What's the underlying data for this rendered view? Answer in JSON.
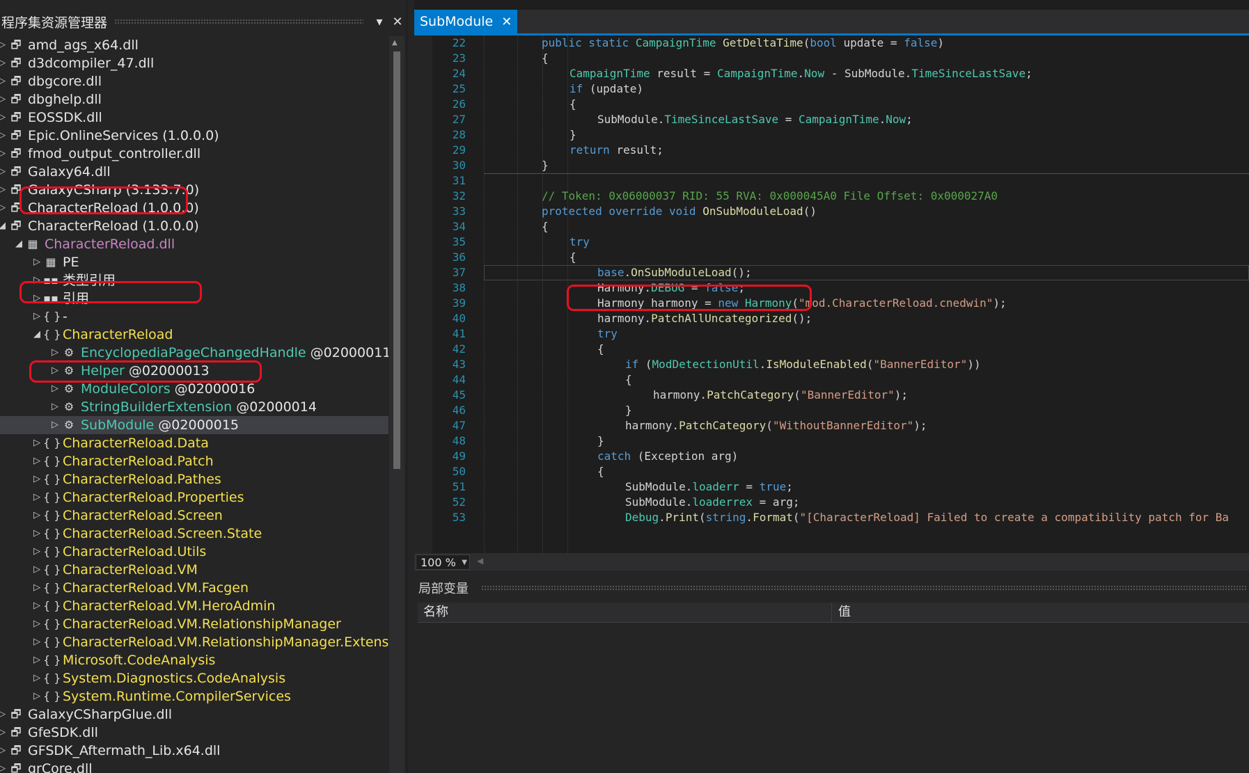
{
  "explorer": {
    "title": "程序集资源管理器",
    "pin_icon": "▾",
    "close_icon": "✕",
    "rows": [
      {
        "level": 0,
        "arrow": "▷",
        "icon": "assembly-icon",
        "glyph": "🗗",
        "text": "amd_ags_x64.dll",
        "color": "white"
      },
      {
        "level": 0,
        "arrow": "▷",
        "icon": "assembly-icon",
        "glyph": "🗗",
        "text": "d3dcompiler_47.dll",
        "color": "white"
      },
      {
        "level": 0,
        "arrow": "▷",
        "icon": "assembly-icon",
        "glyph": "🗗",
        "text": "dbgcore.dll",
        "color": "white"
      },
      {
        "level": 0,
        "arrow": "▷",
        "icon": "assembly-icon",
        "glyph": "🗗",
        "text": "dbghelp.dll",
        "color": "white"
      },
      {
        "level": 0,
        "arrow": "▷",
        "icon": "assembly-icon",
        "glyph": "🗗",
        "text": "EOSSDK.dll",
        "color": "white"
      },
      {
        "level": 0,
        "arrow": "▷",
        "icon": "assembly-icon",
        "glyph": "🗗",
        "text": "Epic.OnlineServices (1.0.0.0)",
        "color": "white"
      },
      {
        "level": 0,
        "arrow": "▷",
        "icon": "assembly-icon",
        "glyph": "🗗",
        "text": "fmod_output_controller.dll",
        "color": "white"
      },
      {
        "level": 0,
        "arrow": "▷",
        "icon": "assembly-icon",
        "glyph": "🗗",
        "text": "Galaxy64.dll",
        "color": "white"
      },
      {
        "level": 0,
        "arrow": "▷",
        "icon": "assembly-icon",
        "glyph": "🗗",
        "text": "GalaxyCSharp (3.133.7.0)",
        "color": "white"
      },
      {
        "level": 0,
        "arrow": "▷",
        "icon": "assembly-icon",
        "glyph": "🗗",
        "text": "CharacterReload (1.0.0.0)",
        "color": "white"
      },
      {
        "level": 0,
        "arrow": "◢",
        "icon": "assembly-icon",
        "glyph": "🗗",
        "text": "CharacterReload (1.0.0.0)",
        "color": "white"
      },
      {
        "level": 1,
        "arrow": "◢",
        "icon": "module-icon",
        "glyph": "▦",
        "text": "CharacterReload.dll",
        "color": "magenta"
      },
      {
        "level": 2,
        "arrow": "▷",
        "icon": "pe-icon",
        "glyph": "▦",
        "text": "PE",
        "color": "white"
      },
      {
        "level": 2,
        "arrow": "▷",
        "icon": "type-ref-icon",
        "glyph": "▪▪",
        "text": "类型引用",
        "color": "white"
      },
      {
        "level": 2,
        "arrow": "▷",
        "icon": "reference-icon",
        "glyph": "▪▪",
        "text": "引用",
        "color": "white"
      },
      {
        "level": 2,
        "arrow": "▷",
        "icon": "namespace-icon",
        "glyph": "{ }",
        "text": "-",
        "color": "white"
      },
      {
        "level": 2,
        "arrow": "◢",
        "icon": "namespace-icon",
        "glyph": "{ }",
        "text": "CharacterReload",
        "color": "yellow"
      },
      {
        "level": 3,
        "arrow": "▷",
        "icon": "class-icon",
        "glyph": "⚙",
        "text": "EncyclopediaPageChangedHandle",
        "token": " @02000011",
        "color": "teal"
      },
      {
        "level": 3,
        "arrow": "▷",
        "icon": "class-icon",
        "glyph": "⚙",
        "text": "Helper",
        "token": " @02000013",
        "color": "teal"
      },
      {
        "level": 3,
        "arrow": "▷",
        "icon": "class-icon",
        "glyph": "⚙",
        "text": "ModuleColors",
        "token": " @02000016",
        "color": "teal"
      },
      {
        "level": 3,
        "arrow": "▷",
        "icon": "class-icon",
        "glyph": "⚙",
        "text": "StringBuilderExtension",
        "token": " @02000014",
        "color": "teal"
      },
      {
        "level": 3,
        "arrow": "▷",
        "icon": "class-icon",
        "glyph": "⚙",
        "text": "SubModule",
        "token": " @02000015",
        "color": "teal",
        "selected": true
      },
      {
        "level": 2,
        "arrow": "▷",
        "icon": "namespace-icon",
        "glyph": "{ }",
        "text": "CharacterReload.Data",
        "color": "yellow"
      },
      {
        "level": 2,
        "arrow": "▷",
        "icon": "namespace-icon",
        "glyph": "{ }",
        "text": "CharacterReload.Patch",
        "color": "yellow"
      },
      {
        "level": 2,
        "arrow": "▷",
        "icon": "namespace-icon",
        "glyph": "{ }",
        "text": "CharacterReload.Pathes",
        "color": "yellow"
      },
      {
        "level": 2,
        "arrow": "▷",
        "icon": "namespace-icon",
        "glyph": "{ }",
        "text": "CharacterReload.Properties",
        "color": "yellow"
      },
      {
        "level": 2,
        "arrow": "▷",
        "icon": "namespace-icon",
        "glyph": "{ }",
        "text": "CharacterReload.Screen",
        "color": "yellow"
      },
      {
        "level": 2,
        "arrow": "▷",
        "icon": "namespace-icon",
        "glyph": "{ }",
        "text": "CharacterReload.Screen.State",
        "color": "yellow"
      },
      {
        "level": 2,
        "arrow": "▷",
        "icon": "namespace-icon",
        "glyph": "{ }",
        "text": "CharacterReload.Utils",
        "color": "yellow"
      },
      {
        "level": 2,
        "arrow": "▷",
        "icon": "namespace-icon",
        "glyph": "{ }",
        "text": "CharacterReload.VM",
        "color": "yellow"
      },
      {
        "level": 2,
        "arrow": "▷",
        "icon": "namespace-icon",
        "glyph": "{ }",
        "text": "CharacterReload.VM.Facgen",
        "color": "yellow"
      },
      {
        "level": 2,
        "arrow": "▷",
        "icon": "namespace-icon",
        "glyph": "{ }",
        "text": "CharacterReload.VM.HeroAdmin",
        "color": "yellow"
      },
      {
        "level": 2,
        "arrow": "▷",
        "icon": "namespace-icon",
        "glyph": "{ }",
        "text": "CharacterReload.VM.RelationshipManager",
        "color": "yellow"
      },
      {
        "level": 2,
        "arrow": "▷",
        "icon": "namespace-icon",
        "glyph": "{ }",
        "text": "CharacterReload.VM.RelationshipManager.Extensions",
        "color": "yellow"
      },
      {
        "level": 2,
        "arrow": "▷",
        "icon": "namespace-icon",
        "glyph": "{ }",
        "text": "Microsoft.CodeAnalysis",
        "color": "yellow"
      },
      {
        "level": 2,
        "arrow": "▷",
        "icon": "namespace-icon",
        "glyph": "{ }",
        "text": "System.Diagnostics.CodeAnalysis",
        "color": "yellow"
      },
      {
        "level": 2,
        "arrow": "▷",
        "icon": "namespace-icon",
        "glyph": "{ }",
        "text": "System.Runtime.CompilerServices",
        "color": "yellow"
      },
      {
        "level": 0,
        "arrow": "▷",
        "icon": "assembly-icon",
        "glyph": "🗗",
        "text": "GalaxyCSharpGlue.dll",
        "color": "white"
      },
      {
        "level": 0,
        "arrow": "▷",
        "icon": "assembly-icon",
        "glyph": "🗗",
        "text": "GfeSDK.dll",
        "color": "white"
      },
      {
        "level": 0,
        "arrow": "▷",
        "icon": "assembly-icon",
        "glyph": "🗗",
        "text": "GFSDK_Aftermath_Lib.x64.dll",
        "color": "white"
      },
      {
        "level": 0,
        "arrow": "▷",
        "icon": "assembly-icon",
        "glyph": "🗗",
        "text": "grCore.dll",
        "color": "white"
      }
    ]
  },
  "tab": {
    "label": "SubModule",
    "close": "✕"
  },
  "editor": {
    "lines": [
      {
        "n": "22",
        "indent": 0,
        "tokens": [
          [
            "k",
            "public static "
          ],
          [
            "t",
            "CampaignTime "
          ],
          [
            "m",
            "GetDeltaTime"
          ],
          [
            "p",
            "("
          ],
          [
            "k",
            "bool "
          ],
          [
            "p",
            "update = "
          ],
          [
            "k",
            "false"
          ],
          [
            "p",
            ")"
          ]
        ]
      },
      {
        "n": "23",
        "indent": 0,
        "tokens": [
          [
            "p",
            "{"
          ]
        ]
      },
      {
        "n": "24",
        "indent": 1,
        "tokens": [
          [
            "t",
            "CampaignTime "
          ],
          [
            "p",
            "result = "
          ],
          [
            "t",
            "CampaignTime"
          ],
          [
            "p",
            "."
          ],
          [
            "pr",
            "Now"
          ],
          [
            "p",
            " - SubModule."
          ],
          [
            "pr",
            "TimeSinceLastSave"
          ],
          [
            "p",
            ";"
          ]
        ]
      },
      {
        "n": "25",
        "indent": 1,
        "tokens": [
          [
            "k",
            "if "
          ],
          [
            "p",
            "(update)"
          ]
        ]
      },
      {
        "n": "26",
        "indent": 1,
        "tokens": [
          [
            "p",
            "{"
          ]
        ]
      },
      {
        "n": "27",
        "indent": 2,
        "tokens": [
          [
            "p",
            "SubModule."
          ],
          [
            "pr",
            "TimeSinceLastSave"
          ],
          [
            "p",
            " = "
          ],
          [
            "t",
            "CampaignTime"
          ],
          [
            "p",
            "."
          ],
          [
            "pr",
            "Now"
          ],
          [
            "p",
            ";"
          ]
        ]
      },
      {
        "n": "28",
        "indent": 1,
        "tokens": [
          [
            "p",
            "}"
          ]
        ]
      },
      {
        "n": "29",
        "indent": 1,
        "tokens": [
          [
            "k",
            "return "
          ],
          [
            "p",
            "result;"
          ]
        ]
      },
      {
        "n": "30",
        "indent": 0,
        "tokens": [
          [
            "p",
            "}"
          ]
        ]
      },
      {
        "n": "31",
        "indent": 0,
        "tokens": []
      },
      {
        "n": "32",
        "indent": 0,
        "tokens": [
          [
            "cm",
            "// Token: 0x06000037 RID: 55 RVA: 0x000045A0 File Offset: 0x000027A0"
          ]
        ]
      },
      {
        "n": "33",
        "indent": 0,
        "tokens": [
          [
            "k",
            "protected override void "
          ],
          [
            "m",
            "OnSubModuleLoad"
          ],
          [
            "p",
            "()"
          ]
        ]
      },
      {
        "n": "34",
        "indent": 0,
        "tokens": [
          [
            "p",
            "{"
          ]
        ]
      },
      {
        "n": "35",
        "indent": 1,
        "tokens": [
          [
            "k",
            "try"
          ]
        ]
      },
      {
        "n": "36",
        "indent": 1,
        "tokens": [
          [
            "p",
            "{"
          ]
        ]
      },
      {
        "n": "37",
        "indent": 2,
        "tokens": [
          [
            "k",
            "base"
          ],
          [
            "p",
            "."
          ],
          [
            "m",
            "OnSubModuleLoad"
          ],
          [
            "p",
            "();"
          ]
        ]
      },
      {
        "n": "38",
        "indent": 2,
        "tokens": [
          [
            "p",
            "Harmony."
          ],
          [
            "pr",
            "DEBUG"
          ],
          [
            "p",
            " = "
          ],
          [
            "k",
            "false"
          ],
          [
            "p",
            ";"
          ]
        ]
      },
      {
        "n": "39",
        "indent": 2,
        "tokens": [
          [
            "p",
            "Harmony harmony = "
          ],
          [
            "k",
            "new "
          ],
          [
            "t",
            "Harmony"
          ],
          [
            "p",
            "("
          ],
          [
            "s",
            "\"mod.CharacterReload.cnedwin\""
          ],
          [
            "p",
            ");"
          ]
        ]
      },
      {
        "n": "40",
        "indent": 2,
        "tokens": [
          [
            "p",
            "harmony."
          ],
          [
            "m",
            "PatchAllUncategorized"
          ],
          [
            "p",
            "();"
          ]
        ]
      },
      {
        "n": "41",
        "indent": 2,
        "tokens": [
          [
            "k",
            "try"
          ]
        ]
      },
      {
        "n": "42",
        "indent": 2,
        "tokens": [
          [
            "p",
            "{"
          ]
        ]
      },
      {
        "n": "43",
        "indent": 3,
        "tokens": [
          [
            "k",
            "if "
          ],
          [
            "p",
            "("
          ],
          [
            "t",
            "ModDetectionUtil"
          ],
          [
            "p",
            "."
          ],
          [
            "m",
            "IsModuleEnabled"
          ],
          [
            "p",
            "("
          ],
          [
            "s",
            "\"BannerEditor\""
          ],
          [
            "p",
            "))"
          ]
        ]
      },
      {
        "n": "44",
        "indent": 3,
        "tokens": [
          [
            "p",
            "{"
          ]
        ]
      },
      {
        "n": "45",
        "indent": 4,
        "tokens": [
          [
            "p",
            "harmony."
          ],
          [
            "m",
            "PatchCategory"
          ],
          [
            "p",
            "("
          ],
          [
            "s",
            "\"BannerEditor\""
          ],
          [
            "p",
            ");"
          ]
        ]
      },
      {
        "n": "46",
        "indent": 3,
        "tokens": [
          [
            "p",
            "}"
          ]
        ]
      },
      {
        "n": "47",
        "indent": 3,
        "tokens": [
          [
            "p",
            "harmony."
          ],
          [
            "m",
            "PatchCategory"
          ],
          [
            "p",
            "("
          ],
          [
            "s",
            "\"WithoutBannerEditor\""
          ],
          [
            "p",
            ");"
          ]
        ]
      },
      {
        "n": "48",
        "indent": 2,
        "tokens": [
          [
            "p",
            "}"
          ]
        ]
      },
      {
        "n": "49",
        "indent": 2,
        "tokens": [
          [
            "k",
            "catch "
          ],
          [
            "p",
            "(Exception arg)"
          ]
        ]
      },
      {
        "n": "50",
        "indent": 2,
        "tokens": [
          [
            "p",
            "{"
          ]
        ]
      },
      {
        "n": "51",
        "indent": 3,
        "tokens": [
          [
            "p",
            "SubModule."
          ],
          [
            "pr",
            "loaderr"
          ],
          [
            "p",
            " = "
          ],
          [
            "k",
            "true"
          ],
          [
            "p",
            ";"
          ]
        ]
      },
      {
        "n": "52",
        "indent": 3,
        "tokens": [
          [
            "p",
            "SubModule."
          ],
          [
            "pr",
            "loaderrex"
          ],
          [
            "p",
            " = arg;"
          ]
        ]
      },
      {
        "n": "53",
        "indent": 3,
        "tokens": [
          [
            "t",
            "Debug"
          ],
          [
            "p",
            "."
          ],
          [
            "m",
            "Print"
          ],
          [
            "p",
            "("
          ],
          [
            "k",
            "string"
          ],
          [
            "p",
            "."
          ],
          [
            "m",
            "Format"
          ],
          [
            "p",
            "("
          ],
          [
            "s",
            "\"[CharacterReload] Failed to create a compatibility patch for Ba"
          ]
        ]
      }
    ]
  },
  "zoom": {
    "value": "100 %"
  },
  "locals": {
    "title": "局部变量",
    "col_name": "名称",
    "col_value": "值"
  },
  "colors": {
    "accent": "#007acc",
    "highlight": "#e81123",
    "namespace": "#f4e04d",
    "type": "#4ec9b0",
    "keyword": "#569cd6"
  }
}
